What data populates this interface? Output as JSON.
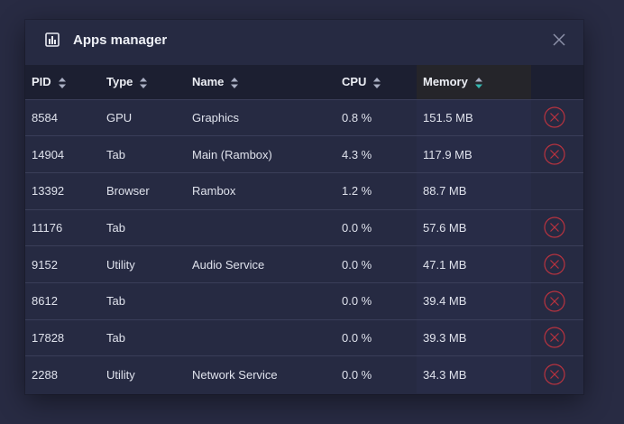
{
  "dialog": {
    "title": "Apps manager",
    "icon": "chart-icon",
    "close_icon": "close-icon"
  },
  "columns": [
    {
      "label": "PID"
    },
    {
      "label": "Type"
    },
    {
      "label": "Name"
    },
    {
      "label": "CPU"
    },
    {
      "label": "Memory",
      "sorted": true
    }
  ],
  "rows": [
    {
      "pid": "8584",
      "type": "GPU",
      "name": "Graphics",
      "cpu": "0.8 %",
      "memory": "151.5 MB",
      "killable": true
    },
    {
      "pid": "14904",
      "type": "Tab",
      "name": "Main (Rambox)",
      "cpu": "4.3 %",
      "memory": "117.9 MB",
      "killable": true
    },
    {
      "pid": "13392",
      "type": "Browser",
      "name": "Rambox",
      "cpu": "1.2 %",
      "memory": "88.7 MB",
      "killable": false
    },
    {
      "pid": "11176",
      "type": "Tab",
      "name": "",
      "cpu": "0.0 %",
      "memory": "57.6 MB",
      "killable": true
    },
    {
      "pid": "9152",
      "type": "Utility",
      "name": "Audio Service",
      "cpu": "0.0 %",
      "memory": "47.1 MB",
      "killable": true
    },
    {
      "pid": "8612",
      "type": "Tab",
      "name": "",
      "cpu": "0.0 %",
      "memory": "39.4 MB",
      "killable": true
    },
    {
      "pid": "17828",
      "type": "Tab",
      "name": "",
      "cpu": "0.0 %",
      "memory": "39.3 MB",
      "killable": true
    },
    {
      "pid": "2288",
      "type": "Utility",
      "name": "Network Service",
      "cpu": "0.0 %",
      "memory": "34.3 MB",
      "killable": true
    }
  ],
  "colors": {
    "accent_sort": "#35b8b0",
    "kill_icon": "#b8333f",
    "background": "#282b43",
    "header_bg": "#1c1f31"
  }
}
